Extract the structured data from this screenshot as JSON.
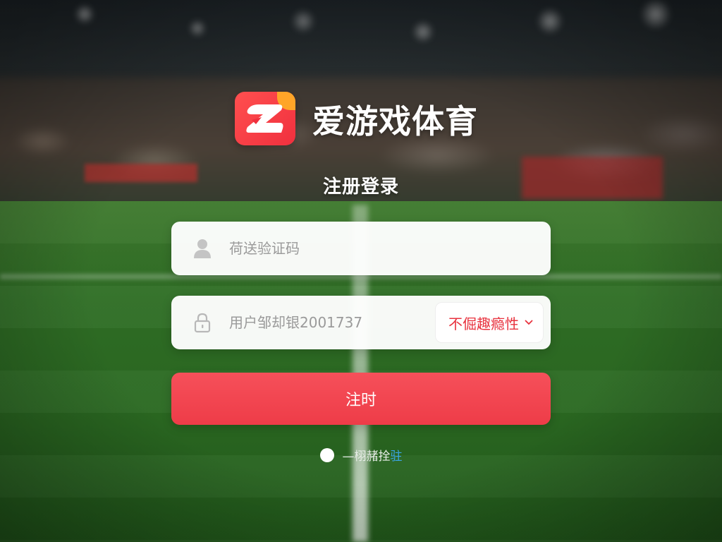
{
  "brand": {
    "name": "爱游戏体育",
    "logo_icon": "z-logo-icon",
    "colors": {
      "primary": "#f0303e",
      "accent": "#ffa528"
    }
  },
  "page": {
    "title": "注册登录"
  },
  "form": {
    "phone": {
      "placeholder": "荷送验证码",
      "icon": "user-icon"
    },
    "code": {
      "placeholder": "用户邹却银2001737",
      "icon": "lock-icon",
      "button_label": "不倔趣瘾性",
      "button_icon": "chevron-down-icon"
    },
    "submit_label": "注时",
    "agreement": {
      "prefix": "—栩赭拴",
      "link": "驻",
      "link_color": "#3aa6e8"
    }
  }
}
